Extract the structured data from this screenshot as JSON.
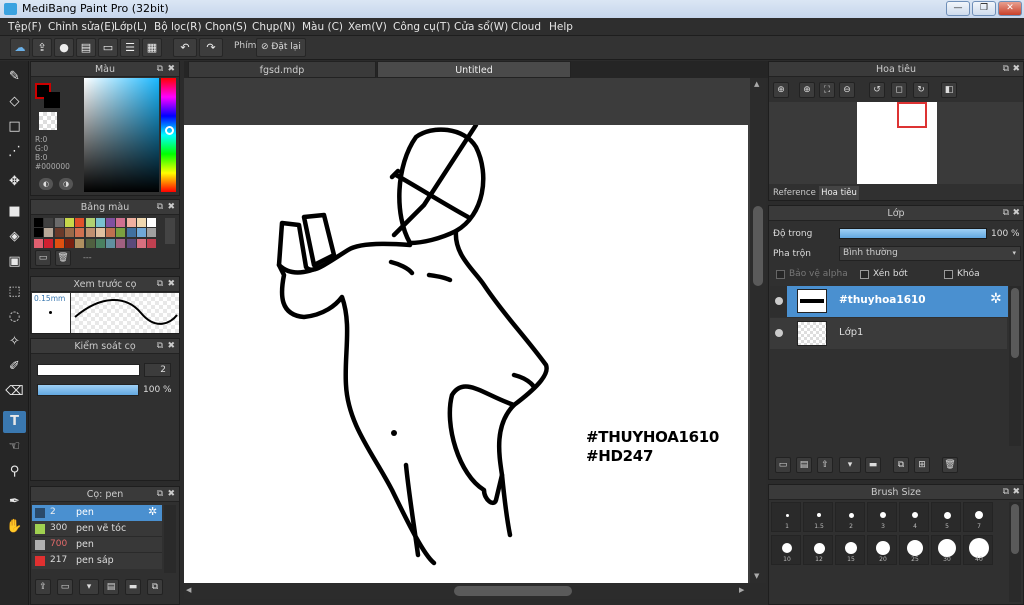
{
  "window": {
    "title": "MediBang Paint Pro (32bit)",
    "minimize_icon": "minimize-icon",
    "maximize_icon": "maximize-icon",
    "close_icon": "close-icon"
  },
  "menu": [
    "Tệp(F)",
    "Chỉnh sửa(E)",
    "Lớp(L)",
    "Bộ lọc(R)",
    "Chọn(S)",
    "Chụp(N)",
    "Màu (C)",
    "Xem(V)",
    "Công cụ(T)",
    "Cửa sổ(W)",
    "Cloud",
    "Help"
  ],
  "toolbar": {
    "icons": [
      "cloud-icon",
      "share-icon",
      "chat-icon",
      "comment-icon",
      "page-icon",
      "list-icon",
      "grid-icon",
      "undo-icon",
      "redo-icon"
    ],
    "shortcut_label": "Phím",
    "reset_label": "Đặt lại"
  },
  "tools": [
    "brush-icon",
    "eraser-icon",
    "rectangle-icon",
    "dot-icon",
    "move-icon",
    "fill-rect-icon",
    "bucket-icon",
    "gradient-icon",
    "select-rect-icon",
    "lasso-icon",
    "magic-wand-icon",
    "select-pen-icon",
    "select-eraser-icon",
    "text-icon",
    "hand-icon",
    "eyedropper-icon",
    "pen-icon",
    "pan-icon"
  ],
  "color_panel": {
    "title": "Màu",
    "fg": "#000000",
    "r": "R:0",
    "g": "G:0",
    "b": "B:0",
    "hex": "#000000"
  },
  "palette_panel": {
    "title": "Bảng màu",
    "colors": [
      "#000000",
      "#404040",
      "#6b6b6b",
      "#c8d84a",
      "#e0502a",
      "#b0d070",
      "#78c0d0",
      "#8050a0",
      "#d07090",
      "#f0b0a0",
      "#f0d8b0",
      "#ffffff",
      "#000000",
      "#b8a898",
      "#6a3a2a",
      "#9a6a4a",
      "#d07050",
      "#c09070",
      "#e0c0a0",
      "#c07050",
      "#7aa040",
      "#4070a0",
      "#70a8d8",
      "#a0a0a0",
      "#e06070",
      "#d02030",
      "#e05010",
      "#7a2010",
      "#b09060",
      "#506040",
      "#4a8060",
      "#6090a0",
      "#a06080",
      "#5a4a7a",
      "#d87080",
      "#c04050"
    ],
    "more_label": "---"
  },
  "brush_preview": {
    "title": "Xem trước cọ",
    "size": "0.15mm"
  },
  "brush_control": {
    "title": "Kiểm soát cọ",
    "size_value": "2",
    "opacity_value": "100 %"
  },
  "brush_list": {
    "title": "Cọ: pen",
    "items": [
      {
        "size": "2",
        "name": "pen",
        "color": "#2a4a6a"
      },
      {
        "size": "300",
        "name": "pen vẽ tóc",
        "color": "#a0d050"
      },
      {
        "size": "700",
        "name": "pen",
        "color": "#b0b0b0"
      },
      {
        "size": "217",
        "name": "pen sáp",
        "color": "#e03030"
      }
    ]
  },
  "tabs": [
    "fgsd.mdp",
    "Untitled"
  ],
  "canvas_text": [
    "#THUYHOA1610",
    "#HD247"
  ],
  "navigator": {
    "title": "Hoa tiêu",
    "tab_reference": "Reference",
    "tab_navigator": "Hoa tiêu"
  },
  "layer_panel": {
    "title": "Lớp",
    "opacity_label": "Độ trong",
    "opacity_value": "100 %",
    "opacity_fraction": 1.0,
    "blend_label": "Pha trộn",
    "blend_value": "Bình thường",
    "protect_alpha": "Bảo vệ alpha",
    "clip": "Xén bớt",
    "lock": "Khóa",
    "layers": [
      {
        "name": "#thuyhoa1610",
        "selected": true
      },
      {
        "name": "Lớp1",
        "selected": false
      }
    ]
  },
  "brush_size_panel": {
    "title": "Brush Size",
    "sizes": [
      "1",
      "1.5",
      "2",
      "3",
      "4",
      "5",
      "7",
      "10",
      "12",
      "15",
      "20",
      "25",
      "30",
      "40"
    ]
  }
}
